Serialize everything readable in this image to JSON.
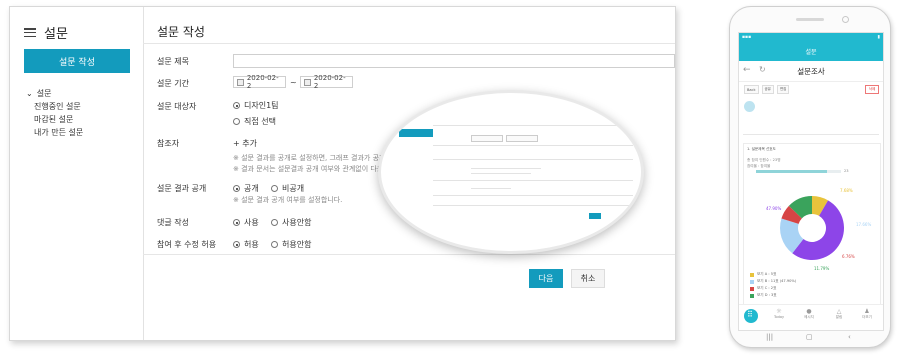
{
  "sidebar": {
    "title": "설문",
    "create_button": "설문 작성",
    "tree_root": "설문",
    "items": [
      "진행중인 설문",
      "마감된 설문",
      "내가 만든 설문"
    ]
  },
  "main": {
    "page_title": "설문 작성",
    "labels": {
      "title": "설문 제목",
      "period": "설문 기간",
      "target": "설문 대상자",
      "participants": "참조자",
      "result_public": "설문 결과 공개",
      "comments": "댓글 작성",
      "edit_after": "참여 후 수정 허용"
    },
    "period": {
      "start": "2020-02-2",
      "separator": "~",
      "end": "2020-02-2"
    },
    "target_options": [
      {
        "label": "디자인1팀",
        "checked": true
      },
      {
        "label": "직접 선택",
        "checked": false
      }
    ],
    "add_participant": "+ 추가",
    "participant_notes": [
      "※ 설문 결과를 공개로 설정하면, 그래프 결과가 공개됩니다",
      "※ 결과 문서는 설문결과 공개 여부와 관계없이 다운로드"
    ],
    "result_options": [
      {
        "label": "공개",
        "checked": true
      },
      {
        "label": "비공개",
        "checked": false
      }
    ],
    "result_note": "※ 설문 결과 공개 여부를 설정합니다.",
    "comment_options": [
      {
        "label": "사용",
        "checked": true
      },
      {
        "label": "사용안함",
        "checked": false
      }
    ],
    "edit_options": [
      {
        "label": "허용",
        "checked": true
      },
      {
        "label": "허용안함",
        "checked": false
      }
    ],
    "next_button": "다음",
    "cancel_button": "취소"
  },
  "mobile": {
    "app_bar": "설문",
    "page_title": "설문조사",
    "chips": [
      "Back",
      "공유",
      "편집"
    ],
    "delete": "삭제",
    "question": "1. 설문제목 선호도",
    "participation_label": "총 참여 인원수 : 23명",
    "rate_label": "참여율 : 참여율",
    "rate_value": "23",
    "progress_fraction": 0.83,
    "pie_labels": [
      "7.68%",
      "47.90%",
      "17.66%",
      "6.76%",
      "11.79%"
    ],
    "pie_values": [
      7.68,
      47.9,
      17.66,
      6.76,
      11.79
    ],
    "pie_colors": [
      "#e8c33c",
      "#8d45e8",
      "#a9d3f5",
      "#d64545",
      "#3aa35c"
    ],
    "legend": [
      {
        "label": "보기 A : 5표",
        "color": "#e8c33c"
      },
      {
        "label": "보기 B : 11표 (47.90%)",
        "color": "#a9d3f5"
      },
      {
        "label": "보기 C : 2표",
        "color": "#d64545"
      },
      {
        "label": "보기 D : 3표",
        "color": "#3aa35c"
      }
    ],
    "bottom_nav": [
      "Today",
      "메시지",
      "알림",
      "더보기"
    ]
  },
  "colors": {
    "accent": "#139bbd",
    "mobile_accent": "#21b9cf"
  }
}
